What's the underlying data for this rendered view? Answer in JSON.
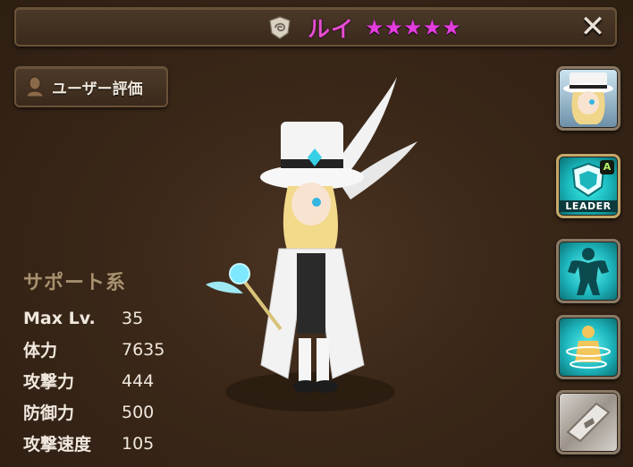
{
  "header": {
    "element_icon": "wind-element-icon",
    "name": "ルイ",
    "stars": [
      "★",
      "★",
      "★",
      "★",
      "★"
    ],
    "close_label": "✕"
  },
  "rating_button": {
    "label": "ユーザー評価",
    "icon": "bust-icon"
  },
  "stats": {
    "type": "サポート系",
    "rows": [
      {
        "label": "Max Lv.",
        "value": "35"
      },
      {
        "label": "体力",
        "value": "7635"
      },
      {
        "label": "攻撃力",
        "value": "444"
      },
      {
        "label": "防御力",
        "value": "500"
      },
      {
        "label": "攻撃速度",
        "value": "105"
      }
    ]
  },
  "side_buttons": {
    "leader_label": "LEADER",
    "leader_badge": "A",
    "icons": [
      "portrait-icon",
      "leader-skill-icon",
      "muscle-skill-icon",
      "buff-skill-icon",
      "card-skill-icon"
    ]
  },
  "colors": {
    "name": "#e44ed0",
    "stars": "#e23ddd",
    "accent_teal": "#1eb6bd"
  }
}
